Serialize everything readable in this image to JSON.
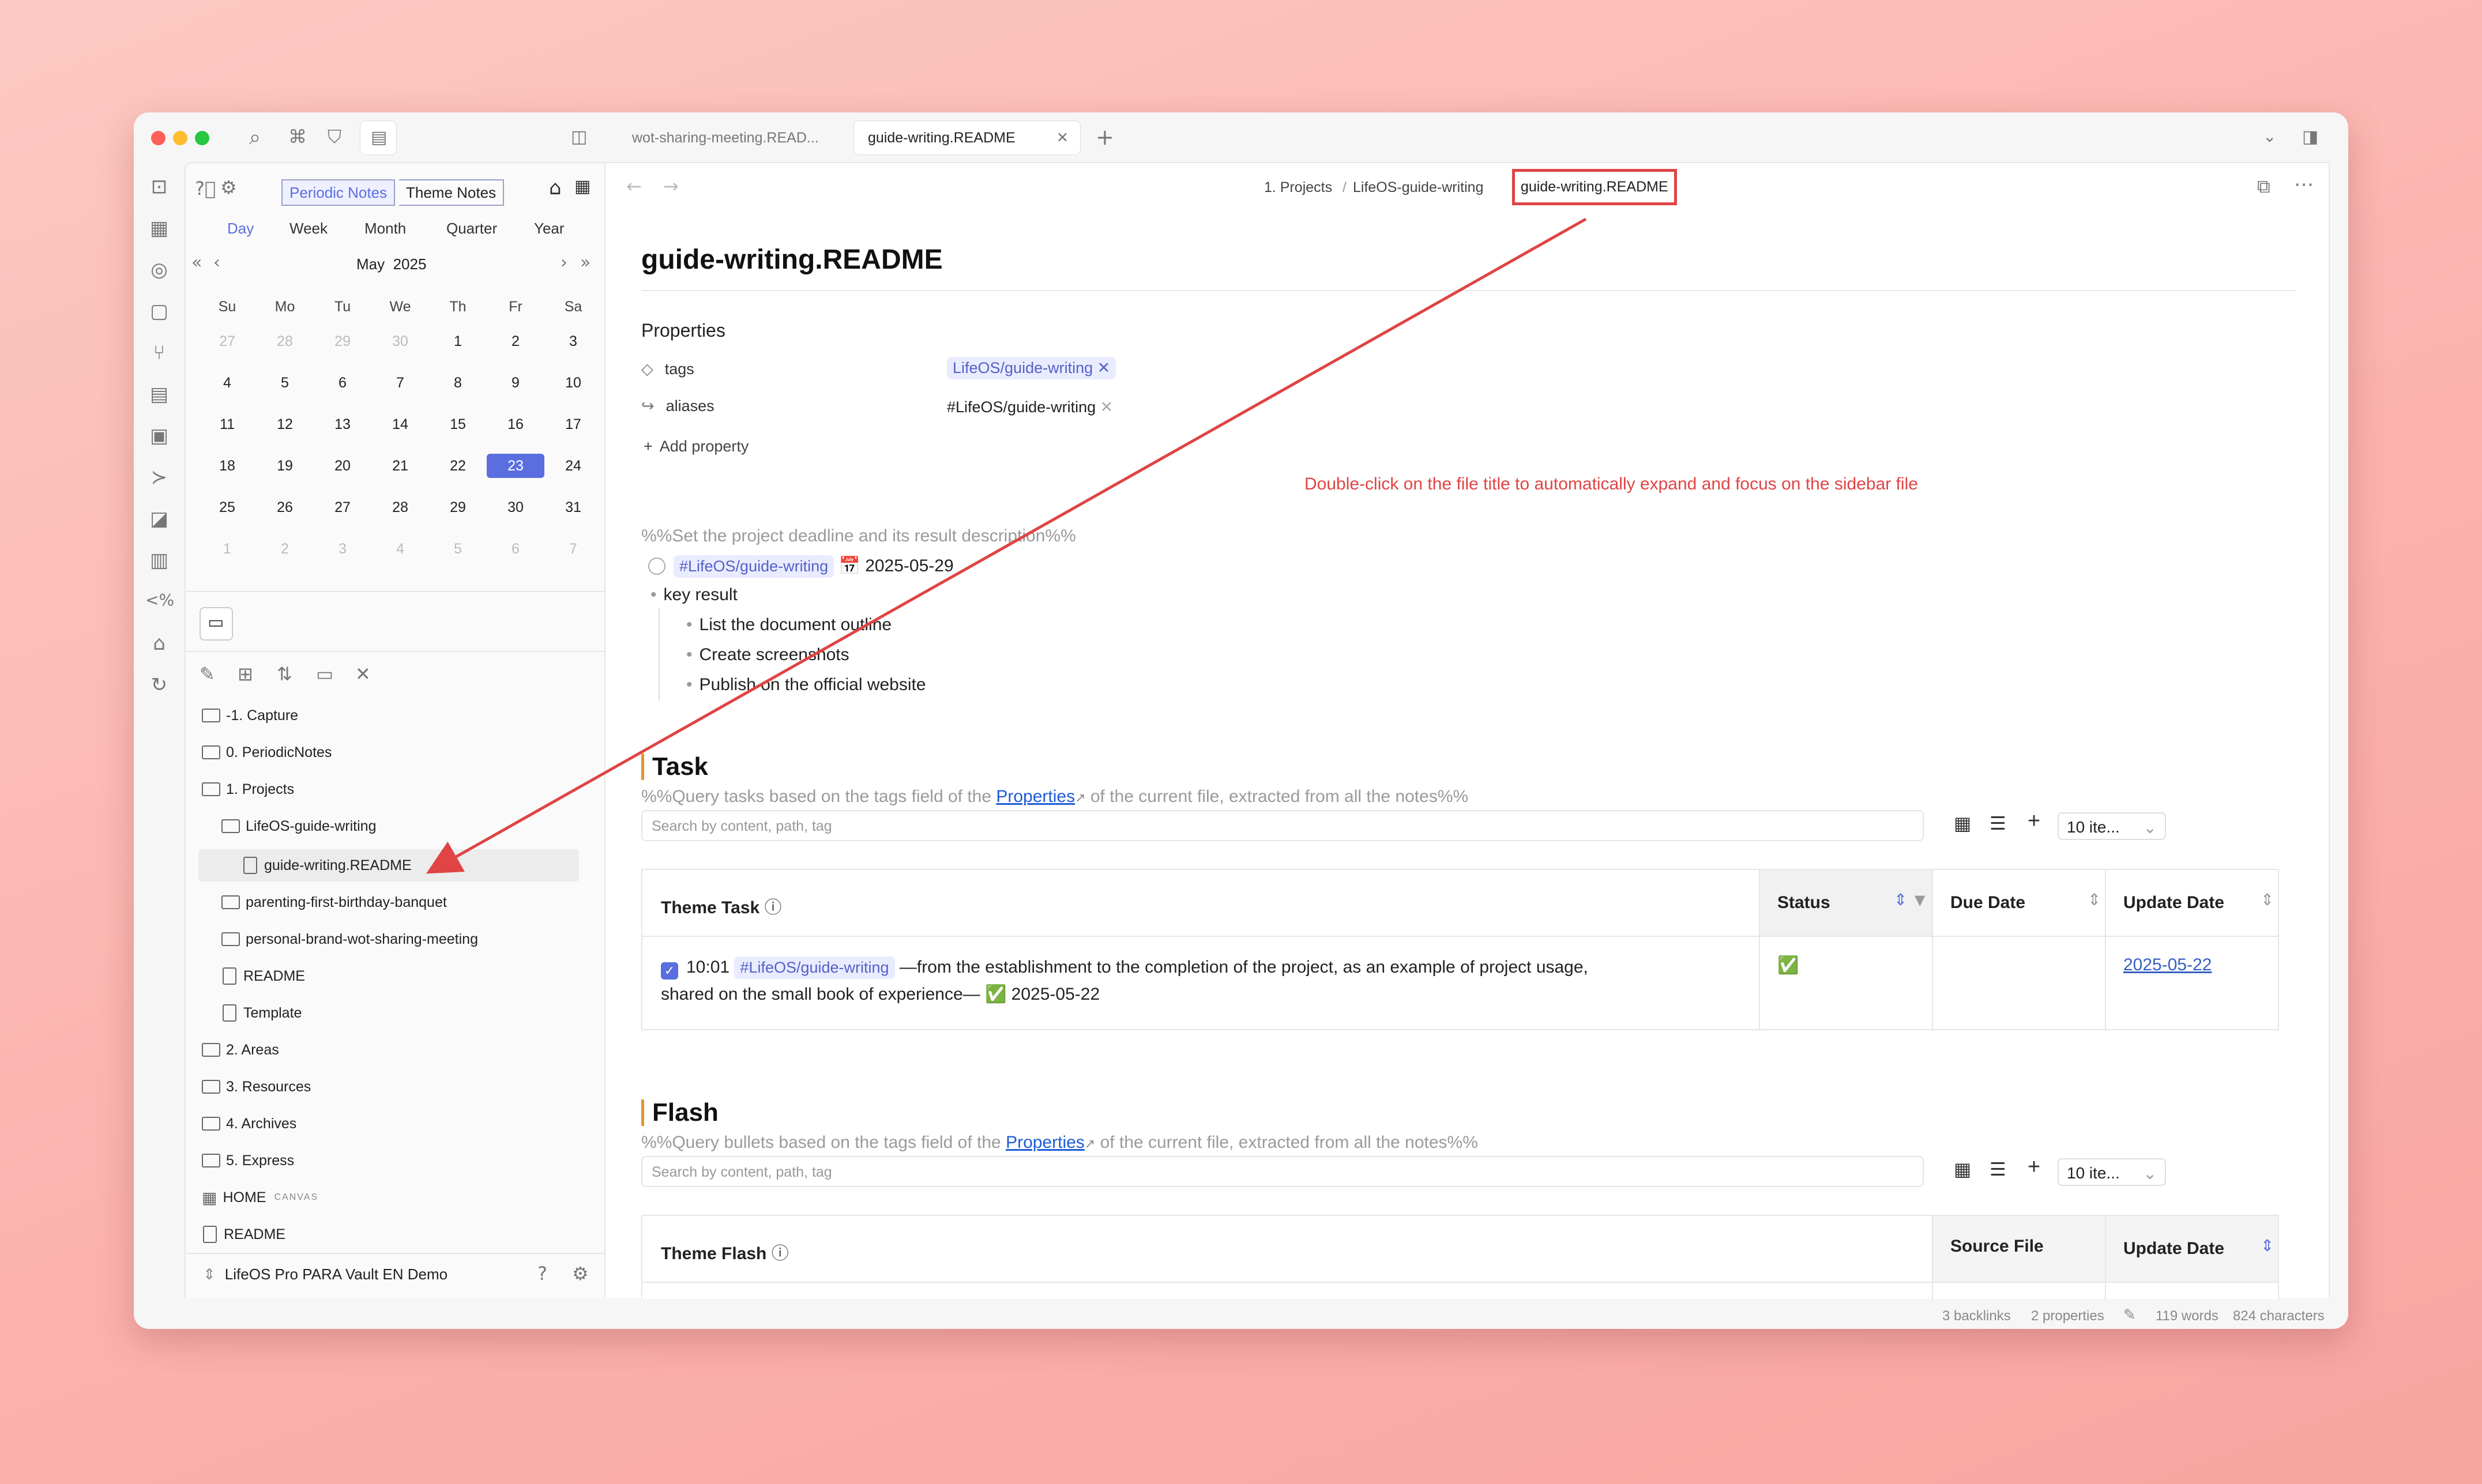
{
  "tabs": [
    {
      "label": "wot-sharing-meeting.READ..."
    },
    {
      "label": "guide-writing.README"
    }
  ],
  "calendar": {
    "modes": [
      "Periodic Notes",
      "Theme Notes"
    ],
    "periods": [
      "Day",
      "Week",
      "Month",
      "Quarter",
      "Year"
    ],
    "month": "May",
    "year": "2025",
    "weekdays": [
      "Su",
      "Mo",
      "Tu",
      "We",
      "Th",
      "Fr",
      "Sa"
    ],
    "weeks": [
      [
        "27",
        "28",
        "29",
        "30",
        "1",
        "2",
        "3"
      ],
      [
        "4",
        "5",
        "6",
        "7",
        "8",
        "9",
        "10"
      ],
      [
        "11",
        "12",
        "13",
        "14",
        "15",
        "16",
        "17"
      ],
      [
        "18",
        "19",
        "20",
        "21",
        "22",
        "23",
        "24"
      ],
      [
        "25",
        "26",
        "27",
        "28",
        "29",
        "30",
        "31"
      ],
      [
        "1",
        "2",
        "3",
        "4",
        "5",
        "6",
        "7"
      ]
    ],
    "selected": "23"
  },
  "tree": {
    "items": [
      "-1. Capture",
      "0. PeriodicNotes",
      "1. Projects",
      "LifeOS-guide-writing",
      "guide-writing.README",
      "parenting-first-birthday-banquet",
      "personal-brand-wot-sharing-meeting",
      "README",
      "Template",
      "2. Areas",
      "3. Resources",
      "4. Archives",
      "5. Express",
      "HOME",
      "README"
    ],
    "canvas_badge": "CANVAS"
  },
  "vault": {
    "name": "LifeOS Pro PARA Vault EN Demo"
  },
  "breadcrumb": {
    "part1": "1. Projects",
    "part2": "LifeOS-guide-writing",
    "current": "guide-writing.README"
  },
  "doc": {
    "title": "guide-writing.README",
    "properties_label": "Properties",
    "props": [
      {
        "key": "tags",
        "value": "LifeOS/guide-writing"
      },
      {
        "key": "aliases",
        "value": "#LifeOS/guide-writing"
      }
    ],
    "add_property": "Add property",
    "annotation": "Double-click on the file title to automatically expand and focus on the sidebar file",
    "comment1": "%%Set the project deadline and its result description%%",
    "task_tag": "#LifeOS/guide-writing",
    "task_date": "2025-05-29",
    "bullet_key": "key result",
    "bullets": [
      "List the document outline",
      "Create screenshots",
      "Publish on the official website"
    ]
  },
  "task_section": {
    "heading": "Task",
    "comment_a": "%%Query tasks based on the tags field of the ",
    "comment_link": "Properties",
    "comment_b": " of the current file, extracted from all the notes%%",
    "search_placeholder": "Search by content, path, tag",
    "items_dropdown": "10 ite...",
    "columns": [
      "Theme Task",
      "Status",
      "Due Date",
      "Update Date"
    ],
    "row": {
      "time": "10:01",
      "tag": "#LifeOS/guide-writing",
      "text1": "—from the establishment to the completion of the project, as an example of project usage,",
      "text2": "shared on the small book of experience— ✅ 2025-05-22",
      "status": "✅",
      "due": "",
      "update": "2025-05-22"
    }
  },
  "flash_section": {
    "heading": "Flash",
    "comment_a": "%%Query bullets based on the tags field of the ",
    "comment_link": "Properties",
    "comment_b": " of the current file, extracted from all the notes%%",
    "search_placeholder": "Search by content, path, tag",
    "items_dropdown": "10 ite...",
    "columns": [
      "Theme Flash",
      "Source File",
      "Update Date"
    ]
  },
  "statusbar": {
    "backlinks": "3 backlinks",
    "properties": "2 properties",
    "words": "119 words",
    "chars": "824 characters"
  },
  "colors": {
    "accent": "#5a6ee0",
    "annotation": "#e04444",
    "heading_bar": "#e3952b"
  }
}
